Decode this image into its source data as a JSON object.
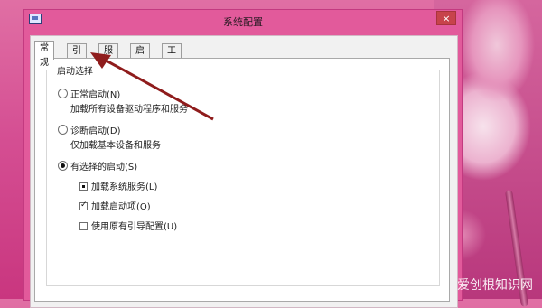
{
  "window": {
    "title": "系统配置",
    "close_label": "×"
  },
  "tabs": [
    {
      "label": "常规",
      "active": true
    },
    {
      "label": "引导",
      "active": false
    },
    {
      "label": "服务",
      "active": false
    },
    {
      "label": "启动",
      "active": false
    },
    {
      "label": "工具",
      "active": false
    }
  ],
  "startup_group": {
    "title": "启动选择",
    "options": {
      "normal": {
        "label": "正常启动(N)",
        "description": "加载所有设备驱动程序和服务",
        "selected": false
      },
      "diagnostic": {
        "label": "诊断启动(D)",
        "description": "仅加载基本设备和服务",
        "selected": false
      },
      "selective": {
        "label": "有选择的启动(S)",
        "selected": true
      }
    },
    "checks": {
      "load_services": {
        "label": "加载系统服务(L)",
        "state": "indeterminate"
      },
      "load_startup": {
        "label": "加载启动项(O)",
        "state": "checked"
      },
      "use_original": {
        "label": "使用原有引导配置(U)",
        "state": "unchecked"
      }
    }
  },
  "annotation": {
    "arrow_color": "#8f1c1c"
  },
  "watermark": "爱创根知识网"
}
